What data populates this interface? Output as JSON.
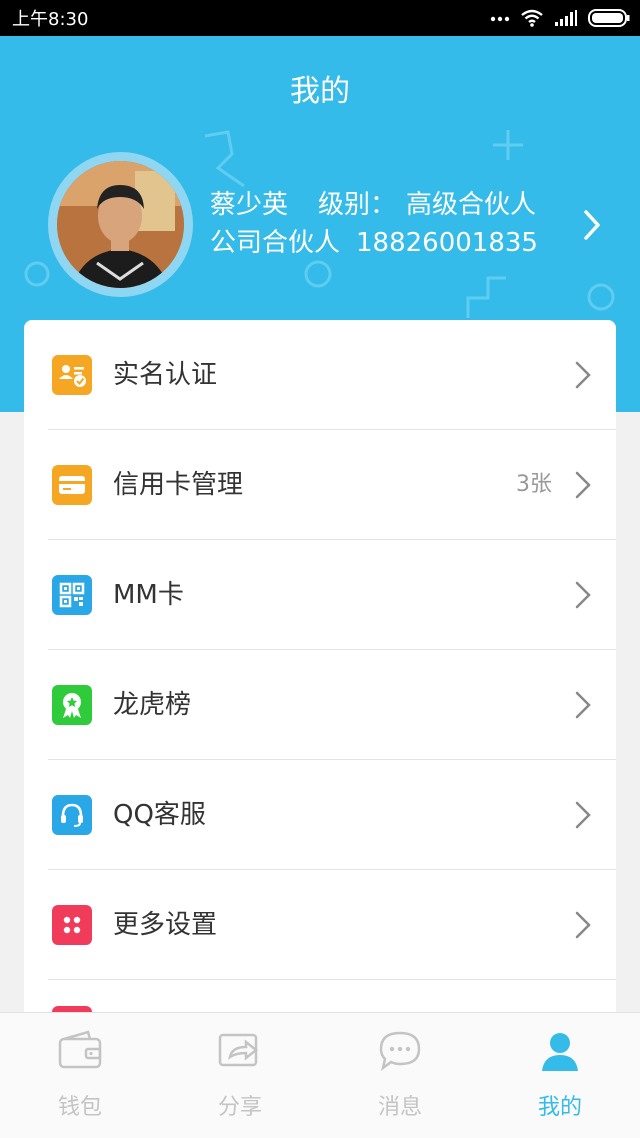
{
  "status_bar": {
    "time": "上午8:30"
  },
  "header": {
    "title": "我的"
  },
  "profile": {
    "name": "蔡少英",
    "level_label": "级别：",
    "level_value": "高级合伙人",
    "role": "公司合伙人",
    "phone": "18826001835"
  },
  "menu": [
    {
      "label": "实名认证",
      "icon": "id-card-check-icon",
      "color": "#f5a623",
      "badge": ""
    },
    {
      "label": "信用卡管理",
      "icon": "credit-card-icon",
      "color": "#f5a623",
      "badge": "3张"
    },
    {
      "label": "MM卡",
      "icon": "qr-code-icon",
      "color": "#2aa7e6",
      "badge": ""
    },
    {
      "label": "龙虎榜",
      "icon": "award-medal-icon",
      "color": "#2fcb3b",
      "badge": ""
    },
    {
      "label": "QQ客服",
      "icon": "headset-icon",
      "color": "#2aa7e6",
      "badge": ""
    },
    {
      "label": "更多设置",
      "icon": "grid-dots-icon",
      "color": "#f03c5a",
      "badge": ""
    }
  ],
  "tabs": [
    {
      "label": "钱包",
      "icon": "wallet-icon",
      "active": false
    },
    {
      "label": "分享",
      "icon": "share-icon",
      "active": false
    },
    {
      "label": "消息",
      "icon": "chat-bubble-icon",
      "active": false
    },
    {
      "label": "我的",
      "icon": "user-icon",
      "active": true
    }
  ],
  "colors": {
    "primary": "#35bbe9",
    "inactive": "#c4c4c4"
  }
}
